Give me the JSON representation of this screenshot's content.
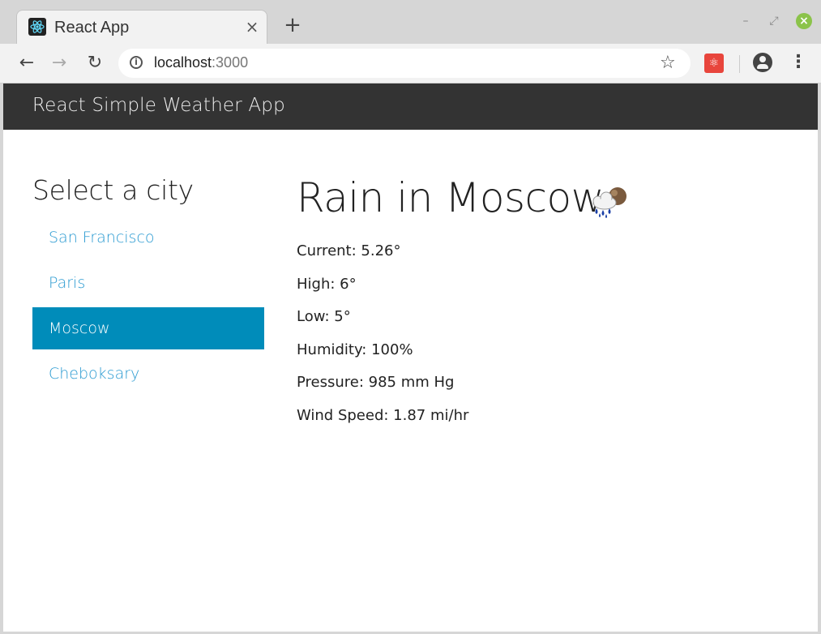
{
  "browser": {
    "tab_title": "React App",
    "tab_close": "×",
    "new_tab": "+",
    "url_host": "localhost",
    "url_port": ":3000"
  },
  "app": {
    "title": "React Simple Weather App"
  },
  "sidebar": {
    "heading": "Select a city",
    "cities": [
      {
        "label": "San Francisco",
        "selected": false
      },
      {
        "label": "Paris",
        "selected": false
      },
      {
        "label": "Moscow",
        "selected": true
      },
      {
        "label": "Cheboksary",
        "selected": false
      }
    ]
  },
  "weather": {
    "title": "Rain in Moscow",
    "icon": "rain-cloud-icon",
    "stats": {
      "current": "Current: 5.26°",
      "high": "High: 6°",
      "low": "Low: 5°",
      "humidity": "Humidity: 100%",
      "pressure": "Pressure: 985 mm Hg",
      "wind": "Wind Speed: 1.87 mi/hr"
    }
  },
  "colors": {
    "appbar": "#333333",
    "accent": "#008cba",
    "link": "#2a9ad1"
  }
}
